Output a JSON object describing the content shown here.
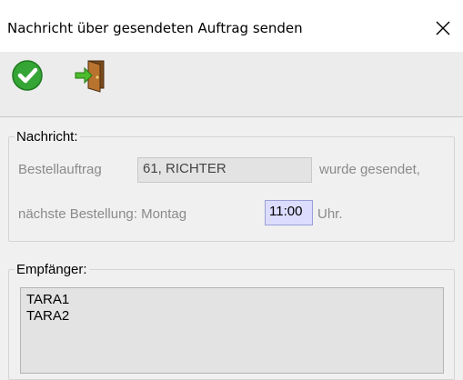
{
  "window": {
    "title": "Nachricht über gesendeten Auftrag senden",
    "close_glyph": "✕"
  },
  "toolbar": {
    "buttons": [
      {
        "icon": "check-circle-icon",
        "color": "#2e9e2e"
      },
      {
        "icon": "exit-door-icon",
        "color": "#2e9e2e"
      }
    ]
  },
  "nachricht": {
    "legend": "Nachricht:",
    "bestellauftrag_label": "Bestellauftrag",
    "bestellauftrag_value": "61, RICHTER",
    "gesendet_text": "wurde gesendet,",
    "naechste_label": "nächste Bestellung: Montag",
    "time_value": "11:00",
    "uhr_label": "Uhr."
  },
  "empfaenger": {
    "legend": "Empfänger:",
    "items": [
      "TARA1",
      "TARA2"
    ]
  }
}
